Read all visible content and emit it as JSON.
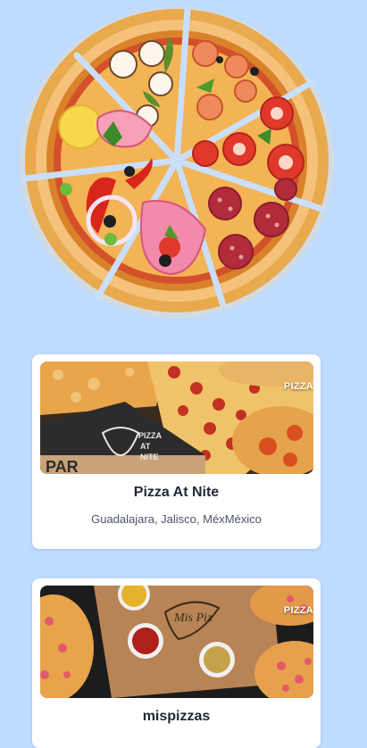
{
  "hero": {
    "image": "pizza-illustration"
  },
  "restaurants": [
    {
      "name": "Pizza At Nite",
      "location": "Guadalajara, Jalisco, MéxMéxico",
      "image_tag": "PIZZA",
      "box_text": "PIZZA AT NITE",
      "box_side_text": "PAR"
    },
    {
      "name": "mispizzas",
      "location": "",
      "image_tag": "PIZZA",
      "box_text": "Mis Piz"
    }
  ],
  "colors": {
    "background": "#bfdbfe",
    "card": "#ffffff",
    "title": "#1f2937",
    "subtitle": "#4b5563"
  }
}
